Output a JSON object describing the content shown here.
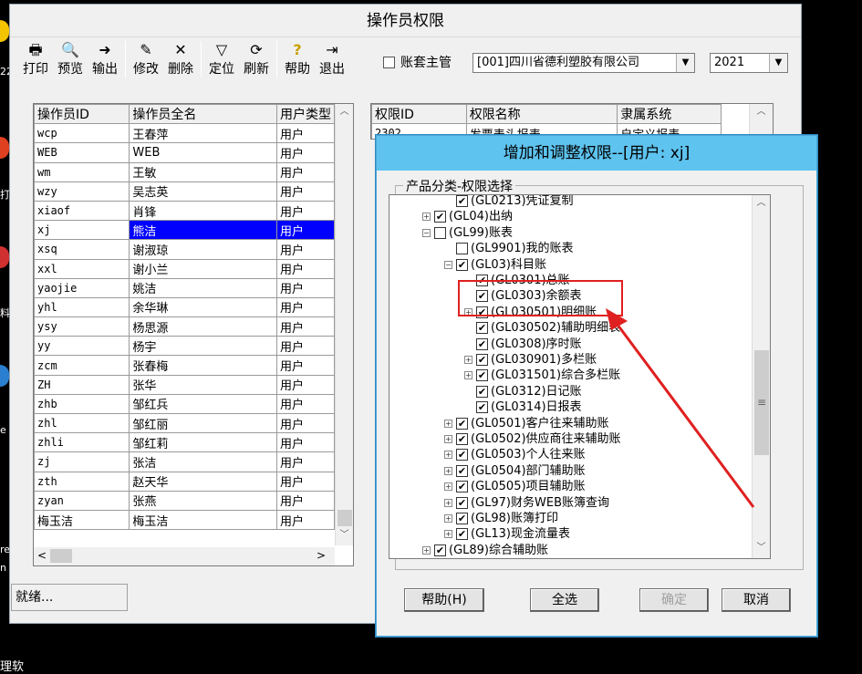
{
  "desktop": {
    "frag1": "e",
    "frag2": "re",
    "frag3": "n",
    "frag4": "理软",
    "frag5": "22",
    "frag6": "打",
    "frag7": "料"
  },
  "window": {
    "title": "操作员权限"
  },
  "toolbar": [
    {
      "label": "打印",
      "icon": "printer-icon",
      "glyph": "🖶"
    },
    {
      "label": "预览",
      "icon": "preview-icon",
      "glyph": "🔍"
    },
    {
      "label": "输出",
      "icon": "export-icon",
      "glyph": "➜"
    },
    {
      "label": "修改",
      "icon": "edit-icon",
      "glyph": "✎"
    },
    {
      "label": "删除",
      "icon": "delete-icon",
      "glyph": "✕"
    },
    {
      "label": "定位",
      "icon": "filter-icon",
      "glyph": "▽"
    },
    {
      "label": "刷新",
      "icon": "refresh-icon",
      "glyph": "⟳"
    },
    {
      "label": "帮助",
      "icon": "help-icon",
      "glyph": "?"
    },
    {
      "label": "退出",
      "icon": "exit-icon",
      "glyph": "⇥"
    }
  ],
  "account_master": {
    "label": "账套主管"
  },
  "account_combo": {
    "value": "[001]四川省德利塑胶有限公司"
  },
  "year_combo": {
    "value": "2021"
  },
  "operators": {
    "headers": [
      "操作员ID",
      "操作员全名",
      "用户类型"
    ],
    "rows": [
      [
        "wcp",
        "王春萍",
        "用户"
      ],
      [
        "WEB",
        "WEB",
        "用户"
      ],
      [
        "wm",
        "王敏",
        "用户"
      ],
      [
        "wzy",
        "吴志英",
        "用户"
      ],
      [
        "xiaof",
        "肖锋",
        "用户"
      ],
      [
        "xj",
        "熊洁",
        "用户"
      ],
      [
        "xsq",
        "谢淑琼",
        "用户"
      ],
      [
        "xxl",
        "谢小兰",
        "用户"
      ],
      [
        "yaojie",
        "姚洁",
        "用户"
      ],
      [
        "yhl",
        "余华琳",
        "用户"
      ],
      [
        "ysy",
        "杨思源",
        "用户"
      ],
      [
        "yy",
        "杨宇",
        "用户"
      ],
      [
        "zcm",
        "张春梅",
        "用户"
      ],
      [
        "ZH",
        "张华",
        "用户"
      ],
      [
        "zhb",
        "邹红兵",
        "用户"
      ],
      [
        "zhl",
        "邹红丽",
        "用户"
      ],
      [
        "zhli",
        "邹红莉",
        "用户"
      ],
      [
        "zj",
        "张洁",
        "用户"
      ],
      [
        "zth",
        "赵天华",
        "用户"
      ],
      [
        "zyan",
        "张燕",
        "用户"
      ],
      [
        "梅玉洁",
        "梅玉洁",
        "用户"
      ]
    ],
    "selected_index": 5
  },
  "permissions": {
    "headers": [
      "权限ID",
      "权限名称",
      "隶属系统"
    ],
    "rows": [
      [
        "2302",
        "发票表头报表",
        "自定义报表"
      ]
    ]
  },
  "status": {
    "text": "就绪..."
  },
  "dialog": {
    "title": "增加和调整权限--[用户: xj]",
    "group_label": "产品分类-权限选择",
    "tree": [
      {
        "text": "(GL0213)凭证复制",
        "level": 2,
        "checked": true,
        "expander": "none"
      },
      {
        "text": "(GL04)出纳",
        "level": 1,
        "checked": true,
        "expander": "+"
      },
      {
        "text": "(GL99)账表",
        "level": 1,
        "checked": false,
        "expander": "-"
      },
      {
        "text": "(GL9901)我的账表",
        "level": 2,
        "checked": false,
        "expander": "none"
      },
      {
        "text": "(GL03)科目账",
        "level": 2,
        "checked": true,
        "expander": "-"
      },
      {
        "text": "(GL0301)总账",
        "level": 3,
        "checked": true,
        "expander": "none"
      },
      {
        "text": "(GL0303)余额表",
        "level": 3,
        "checked": true,
        "expander": "none"
      },
      {
        "text": "(GL030501)明细账",
        "level": 3,
        "checked": true,
        "expander": "+"
      },
      {
        "text": "(GL030502)辅助明细表",
        "level": 3,
        "checked": true,
        "expander": "none"
      },
      {
        "text": "(GL0308)序时账",
        "level": 3,
        "checked": true,
        "expander": "none"
      },
      {
        "text": "(GL030901)多栏账",
        "level": 3,
        "checked": true,
        "expander": "+"
      },
      {
        "text": "(GL031501)综合多栏账",
        "level": 3,
        "checked": true,
        "expander": "+"
      },
      {
        "text": "(GL0312)日记账",
        "level": 3,
        "checked": true,
        "expander": "none"
      },
      {
        "text": "(GL0314)日报表",
        "level": 3,
        "checked": true,
        "expander": "none"
      },
      {
        "text": "(GL0501)客户往来辅助账",
        "level": 2,
        "checked": true,
        "expander": "+"
      },
      {
        "text": "(GL0502)供应商往来辅助账",
        "level": 2,
        "checked": true,
        "expander": "+"
      },
      {
        "text": "(GL0503)个人往来账",
        "level": 2,
        "checked": true,
        "expander": "+"
      },
      {
        "text": "(GL0504)部门辅助账",
        "level": 2,
        "checked": true,
        "expander": "+"
      },
      {
        "text": "(GL0505)项目辅助账",
        "level": 2,
        "checked": true,
        "expander": "+"
      },
      {
        "text": "(GL97)财务WEB账簿查询",
        "level": 2,
        "checked": true,
        "expander": "+"
      },
      {
        "text": "(GL98)账簿打印",
        "level": 2,
        "checked": true,
        "expander": "+"
      },
      {
        "text": "(GL13)现金流量表",
        "level": 2,
        "checked": true,
        "expander": "+"
      },
      {
        "text": "(GL89)综合辅助账",
        "level": 1,
        "checked": true,
        "expander": "+"
      }
    ],
    "buttons": {
      "help": "帮助(H)",
      "select_all": "全选",
      "ok": "确定",
      "cancel": "取消"
    }
  },
  "colors": {
    "selection": "#0000ff",
    "dialog_title": "#5ec3ef",
    "annotation": "#e02020"
  }
}
